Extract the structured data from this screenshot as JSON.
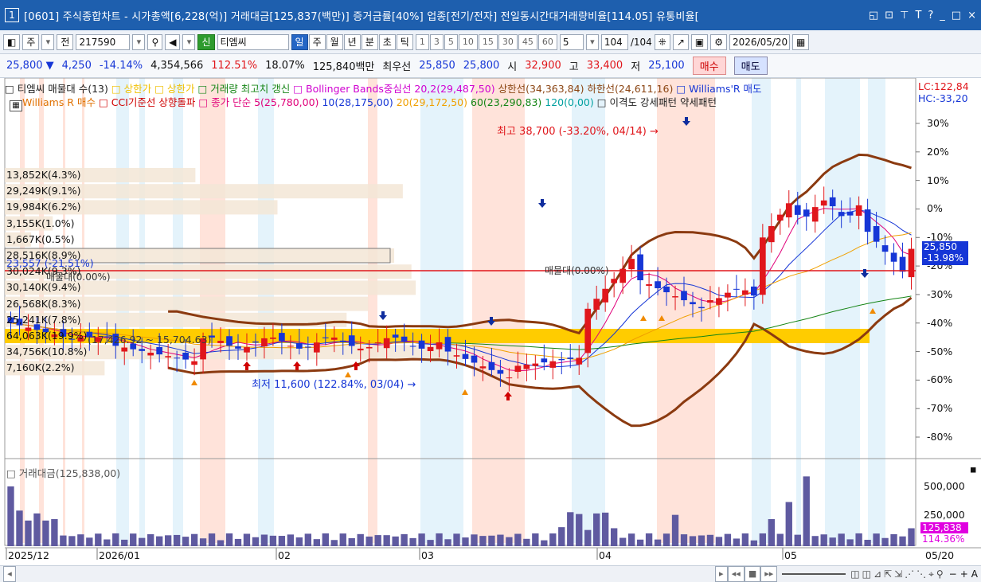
{
  "window": {
    "number": "1",
    "title": "[0601] 주식종합차트 - 시가총액[6,228(억)] 거래대금[125,837(백만)] 증거금률[40%] 업종[전기/전자] 전일동시간대거래량비율[114.05] 유통비율[",
    "controls": [
      "ㅁ",
      "⊡",
      "寿",
      "T",
      "?",
      "|",
      "_",
      "□",
      "×"
    ]
  },
  "toolbar": {
    "mode": "주",
    "market": "전",
    "code": "217590",
    "stock_tag": "신",
    "stock_name": "티엠씨",
    "periods": [
      "일",
      "주",
      "월",
      "년",
      "분",
      "초",
      "틱"
    ],
    "active_period": "일",
    "intervals": [
      "1",
      "3",
      "5",
      "10",
      "15",
      "30",
      "45",
      "60"
    ],
    "interval_value": "5",
    "count": "104",
    "count_total": "/104",
    "date": "2026/05/20"
  },
  "quote": {
    "price": "25,800 ▼",
    "change": "4,250",
    "change_pct": "-14.14%",
    "volume": "4,354,566",
    "volume_ratio": "112.51%",
    "turnover": "18.07%",
    "amount": "125,840백만",
    "best_sell_label": "최우선",
    "best_sell": "25,850",
    "best_buy": "25,800",
    "open_label": "시",
    "open": "32,900",
    "high_label": "고",
    "high": "33,400",
    "low_label": "저",
    "low": "25,100",
    "buy_button": "매수",
    "sell_button": "매도"
  },
  "legend": {
    "line1": [
      {
        "text": "□ 티엠씨 매물대 수(13)",
        "color": "#222222"
      },
      {
        "text": "□ 상한가",
        "color": "#f0c000"
      },
      {
        "text": "□ 상한가",
        "color": "#f0c000"
      },
      {
        "text": "□ 거래량 최고치 갱신",
        "color": "#148414"
      },
      {
        "text": "□ Bollinger Bands중심선 20,2(29,487,50)",
        "color": "#d000d0"
      },
      {
        "text": "상한선(34,363,84)",
        "color": "#8b4513"
      },
      {
        "text": "하한선(24,611,16)",
        "color": "#8b4513"
      },
      {
        "text": "□ Williams'R 매도",
        "color": "#1636d6"
      }
    ],
    "line2": [
      {
        "text": "Williams R 매수",
        "color": "#e07000"
      },
      {
        "text": "□ CCI기준선 상향돌파",
        "color": "#d00000"
      },
      {
        "text": "□ 종가 단순 5(25,780,00)",
        "color": "#e0007a"
      },
      {
        "text": "10(28,175,00)",
        "color": "#1636d6"
      },
      {
        "text": "20(29,172,50)",
        "color": "#f0a000"
      },
      {
        "text": "60(23,290,83)",
        "color": "#148414"
      },
      {
        "text": "120(0,00)",
        "color": "#00a0a0"
      },
      {
        "text": "□ 이격도 강세패턴",
        "color": "#222222"
      },
      {
        "text": "약세패턴",
        "color": "#222222"
      }
    ],
    "lc": "LC:122,84",
    "hc": "HC:-33,20"
  },
  "price_axis": [
    "30%",
    "20%",
    "10%",
    "0%",
    "-10%",
    "-20%",
    "-30%",
    "-40%",
    "-50%",
    "-60%",
    "-70%",
    "-80%"
  ],
  "price_tag": {
    "value": "25,850",
    "pct": "-13.98%"
  },
  "volume_profile": [
    {
      "label": "13,852K(4.3%)",
      "pct": 4.3
    },
    {
      "label": "29,249K(9.1%)",
      "pct": 9.1
    },
    {
      "label": "19,984K(6.2%)",
      "pct": 6.2
    },
    {
      "label": "3,155K(1.0%)",
      "pct": 1.0
    },
    {
      "label": "1,667K(0.5%)",
      "pct": 0.5
    },
    {
      "label": "28,516K(8.9%)",
      "pct": 8.9
    },
    {
      "label": "30,024K(9.3%)",
      "pct": 9.3
    },
    {
      "label": "30,140K(9.4%)",
      "pct": 9.4
    },
    {
      "label": "26,568K(8.3%)",
      "pct": 8.3
    },
    {
      "label": "25,241K(7.8%)",
      "pct": 7.8
    },
    {
      "label": "64,063K(19.9%)",
      "pct": 19.9
    },
    {
      "label": "34,756K(10.8%)",
      "pct": 10.8
    },
    {
      "label": "7,160K(2.2%)",
      "pct": 2.2
    }
  ],
  "annotations": {
    "high": "최고 38,700 (-33.20%, 04/14)",
    "low": "최저 11,600 (122.84%, 03/04)",
    "max_vp": "(17,426.92 ~ 15,704.63)",
    "vp_top": "23,557 (-21.51%)",
    "base": "매물대(0.00%)",
    "base_right": "매물대(0.00%)"
  },
  "chart_data": [
    {
      "type": "candlestick",
      "title": "티엠씨 일봉",
      "period": "2025/12 - 2026/05/20",
      "current_price": 25850,
      "high": 38700,
      "low": 11600,
      "bollinger": {
        "period": 20,
        "mult": 2,
        "mid": 29487.5,
        "upper": 34363.84,
        "lower": 24611.16
      },
      "ma": {
        "5": 25780,
        "10": 28175,
        "20": 29172.5,
        "60": 23290.83,
        "120": 0
      },
      "ylabel": "%"
    },
    {
      "type": "bar",
      "title": "거래대금(125,838,00)",
      "last_value": 125838,
      "last_ratio": "114.36%",
      "yticks": [
        "500,000",
        "250,000"
      ],
      "months": [
        "2025/12",
        "2026/01",
        "02",
        "03",
        "04",
        "05",
        "05/20"
      ]
    }
  ],
  "volume_panel": {
    "title": "□ 거래대금(125,838,00)",
    "yticks": [
      "500,000",
      "250,000"
    ],
    "last_value": "125,838",
    "last_ratio": "114.36%"
  },
  "xaxis": {
    "labels": [
      "2025/12",
      "2026/01",
      "02",
      "03",
      "04",
      "05"
    ],
    "right_label": "05/20"
  }
}
